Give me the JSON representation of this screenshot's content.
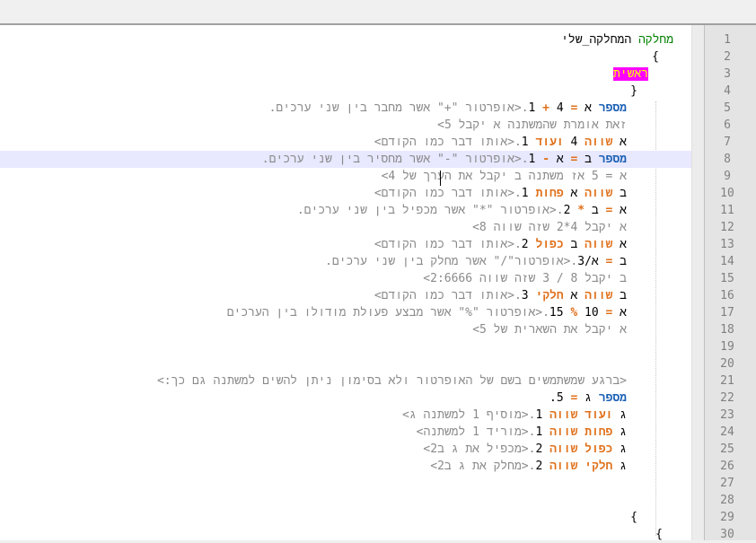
{
  "lines": [
    {
      "n": "1",
      "parts": [
        [
          "cls",
          "מחלקה"
        ],
        [
          "var",
          " המחלקה_שלי"
        ]
      ]
    },
    {
      "n": "2",
      "parts": [
        [
          "brace",
          "{"
        ]
      ]
    },
    {
      "n": "3",
      "parts": [
        [
          "magenta",
          "ראשית"
        ]
      ]
    },
    {
      "n": "4",
      "parts": [
        [
          "brace",
          "}"
        ]
      ]
    },
    {
      "n": "5",
      "parts": [
        [
          "kw",
          "מספר"
        ],
        [
          "var",
          " א "
        ],
        [
          "op",
          "="
        ],
        [
          "num",
          " 4 "
        ],
        [
          "op",
          "+"
        ],
        [
          "num",
          " 1"
        ],
        [
          "cmt",
          ".<אופרטור \"+\" אשר מחבר בין שני ערכים."
        ]
      ]
    },
    {
      "n": "6",
      "parts": [
        [
          "cmt",
          "זאת אומרת שהמשתנה א יקבל 5>"
        ]
      ]
    },
    {
      "n": "7",
      "parts": [
        [
          "var",
          "א "
        ],
        [
          "kw2",
          "שווה"
        ],
        [
          "num",
          " 4 "
        ],
        [
          "kw2",
          "ועוד"
        ],
        [
          "num",
          " 1"
        ],
        [
          "cmt",
          ".<אותו דבר כמו הקודם>"
        ]
      ]
    },
    {
      "n": "8",
      "parts": [
        [
          "kw",
          "מספר"
        ],
        [
          "var",
          " ב "
        ],
        [
          "op",
          "="
        ],
        [
          "var",
          " א "
        ],
        [
          "op",
          "-"
        ],
        [
          "num",
          " 1"
        ],
        [
          "cmt",
          ".<אופרטור \"-\" אשר מחסיר בין שני ערכים."
        ]
      ]
    },
    {
      "n": "9",
      "parts": [
        [
          "cmt",
          "א = 5 אז משתנה ב יקבל את הערך של 4>"
        ]
      ]
    },
    {
      "n": "10",
      "parts": [
        [
          "var",
          "ב "
        ],
        [
          "kw2",
          "שווה"
        ],
        [
          "var",
          " א "
        ],
        [
          "kw2",
          "פחות"
        ],
        [
          "num",
          " 1"
        ],
        [
          "cmt",
          ".<אותו דבר כמו הקודם>"
        ]
      ]
    },
    {
      "n": "11",
      "parts": [
        [
          "var",
          "א "
        ],
        [
          "op",
          "="
        ],
        [
          "var",
          " ב "
        ],
        [
          "op",
          "*"
        ],
        [
          "num",
          " 2"
        ],
        [
          "cmt",
          ".<אופרטור \"*\" אשר מכפיל בין שני ערכים."
        ]
      ]
    },
    {
      "n": "12",
      "parts": [
        [
          "cmt",
          "א יקבל 4*2 שזה שווה 8>"
        ]
      ]
    },
    {
      "n": "13",
      "parts": [
        [
          "var",
          "א "
        ],
        [
          "kw2",
          "שווה"
        ],
        [
          "var",
          " ב "
        ],
        [
          "kw2",
          "כפול"
        ],
        [
          "num",
          " 2"
        ],
        [
          "cmt",
          ".<אותו דבר כמו הקודם>"
        ]
      ]
    },
    {
      "n": "14",
      "parts": [
        [
          "var",
          "ב "
        ],
        [
          "op",
          "="
        ],
        [
          "var",
          " א/3"
        ],
        [
          "cmt",
          ".<אופרטור\"/\" אשר מחלק בין שני ערכים."
        ]
      ]
    },
    {
      "n": "15",
      "parts": [
        [
          "cmt",
          "ב יקבל 8 / 3 שזה שווה 2:6666>"
        ]
      ]
    },
    {
      "n": "16",
      "parts": [
        [
          "var",
          "ב "
        ],
        [
          "kw2",
          "שווה"
        ],
        [
          "var",
          " א "
        ],
        [
          "kw2",
          "חלקי"
        ],
        [
          "num",
          " 3"
        ],
        [
          "cmt",
          ".<אותו דבר כמו הקודם>"
        ]
      ]
    },
    {
      "n": "17",
      "parts": [
        [
          "var",
          "א "
        ],
        [
          "op",
          "="
        ],
        [
          "num",
          " 10 "
        ],
        [
          "op",
          "%"
        ],
        [
          "num",
          " 15"
        ],
        [
          "cmt",
          ".<אופרטור \"%\" אשר מבצע פעולת מודולו בין הערכים"
        ]
      ]
    },
    {
      "n": "18",
      "parts": [
        [
          "cmt",
          "א יקבל את השארית של 5>"
        ]
      ]
    },
    {
      "n": "19",
      "parts": []
    },
    {
      "n": "20",
      "parts": []
    },
    {
      "n": "21",
      "parts": [
        [
          "cmt",
          "<ברגע שמשתמשים בשם של האופרטור ולא בסימון ניתן להשים למשתנה גם כך:>"
        ]
      ]
    },
    {
      "n": "22",
      "parts": [
        [
          "kw",
          "מספר"
        ],
        [
          "var",
          " ג "
        ],
        [
          "op",
          "="
        ],
        [
          "num",
          " 5."
        ]
      ]
    },
    {
      "n": "23",
      "parts": [
        [
          "var",
          "ג "
        ],
        [
          "kw2",
          "ועוד"
        ],
        [
          "kw2",
          " שווה"
        ],
        [
          "num",
          " 1"
        ],
        [
          "cmt",
          ".<מוסיף 1 למשתנה ג>"
        ]
      ]
    },
    {
      "n": "24",
      "parts": [
        [
          "var",
          "ג "
        ],
        [
          "kw2",
          "פחות"
        ],
        [
          "kw2",
          " שווה"
        ],
        [
          "num",
          " 1"
        ],
        [
          "cmt",
          ".<מוריד 1 למשתנה>"
        ]
      ]
    },
    {
      "n": "25",
      "parts": [
        [
          "var",
          "ג "
        ],
        [
          "kw2",
          "כפול"
        ],
        [
          "kw2",
          " שווה"
        ],
        [
          "num",
          " 2"
        ],
        [
          "cmt",
          ".<מכפיל את ג ב2>"
        ]
      ]
    },
    {
      "n": "26",
      "parts": [
        [
          "var",
          "ג "
        ],
        [
          "kw2",
          "חלקי"
        ],
        [
          "kw2",
          " שווה"
        ],
        [
          "num",
          " 2"
        ],
        [
          "cmt",
          ".<מחלק את ג ב2>"
        ]
      ]
    },
    {
      "n": "27",
      "parts": []
    },
    {
      "n": "28",
      "parts": []
    },
    {
      "n": "29",
      "parts": [
        [
          "brace",
          "{"
        ]
      ]
    },
    {
      "n": "30",
      "parts": [
        [
          "brace",
          "{"
        ]
      ]
    }
  ],
  "highlighted_line": "8"
}
